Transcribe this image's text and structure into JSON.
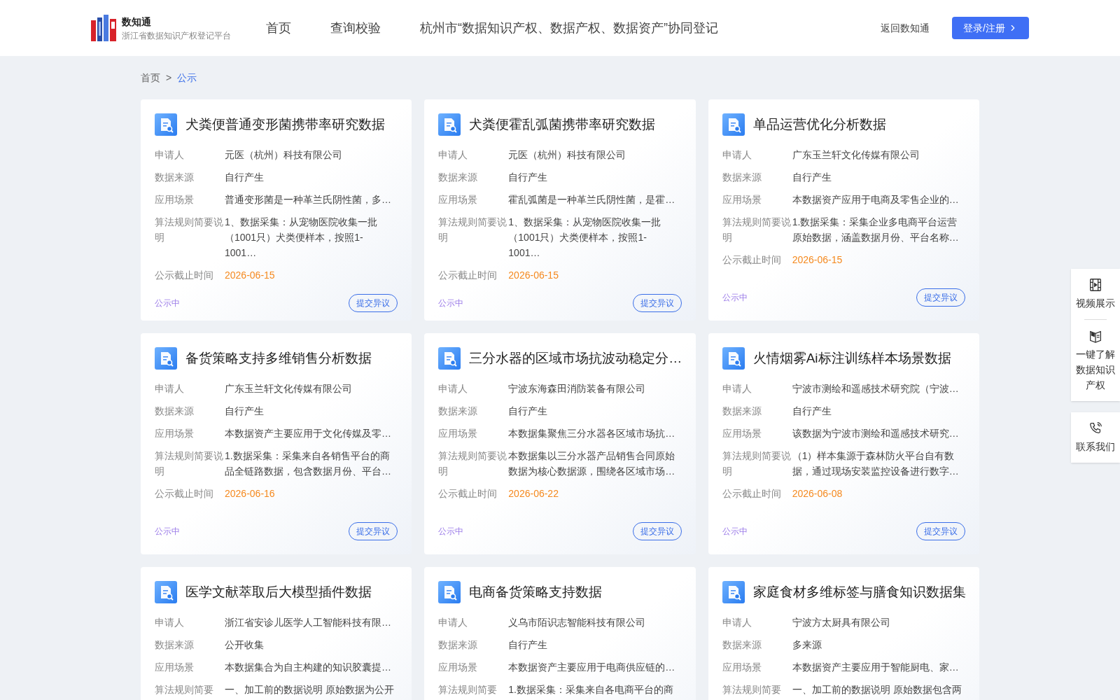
{
  "header": {
    "logo": {
      "title": "数知通",
      "subtitle": "浙江省数据知识产权登记平台"
    },
    "nav": [
      {
        "label": "首页"
      },
      {
        "label": "查询校验"
      },
      {
        "label": "杭州市“数据知识产权、数据产权、数据资产”协同登记"
      }
    ],
    "back_link": "返回数知通",
    "login_button": "登录/注册"
  },
  "breadcrumb": {
    "items": [
      {
        "label": "首页",
        "selected": false
      },
      {
        "label": "公示",
        "selected": true
      }
    ],
    "separator": ">"
  },
  "cards": [
    {
      "title": "犬粪便普通变形菌携带率研究数据",
      "fields": [
        {
          "kind": "text",
          "label": "申请人",
          "value": "元医（杭州）科技有限公司"
        },
        {
          "kind": "text",
          "label": "数据来源",
          "value": "自行产生"
        },
        {
          "kind": "text",
          "label": "应用场景",
          "value": "普通变形菌是一种革兰氏阴性菌，多…"
        },
        {
          "kind": "text",
          "label": "算法规则简要说明",
          "value": "1、数据采集：从宠物医院收集一批（1001只）犬类便样本，按照1-1001…"
        },
        {
          "kind": "date",
          "label": "公示截止时间",
          "value": "2026-06-15"
        }
      ],
      "status": "公示中",
      "action": "提交异议"
    },
    {
      "title": "犬粪便霍乱弧菌携带率研究数据",
      "fields": [
        {
          "kind": "text",
          "label": "申请人",
          "value": "元医（杭州）科技有限公司"
        },
        {
          "kind": "text",
          "label": "数据来源",
          "value": "自行产生"
        },
        {
          "kind": "text",
          "label": "应用场景",
          "value": "霍乱弧菌是一种革兰氏阴性菌，是霍…"
        },
        {
          "kind": "text",
          "label": "算法规则简要说明",
          "value": "1、数据采集：从宠物医院收集一批（1001只）犬类便样本，按照1-1001…"
        },
        {
          "kind": "date",
          "label": "公示截止时间",
          "value": "2026-06-15"
        }
      ],
      "status": "公示中",
      "action": "提交异议"
    },
    {
      "title": "单品运营优化分析数据",
      "fields": [
        {
          "kind": "text",
          "label": "申请人",
          "value": "广东玉兰轩文化传媒有限公司"
        },
        {
          "kind": "text",
          "label": "数据来源",
          "value": "自行产生"
        },
        {
          "kind": "text",
          "label": "应用场景",
          "value": "本数据资产应用于电商及零售企业的…"
        },
        {
          "kind": "text",
          "label": "算法规则简要说明",
          "value": "1.数据采集：采集企业多电商平台运营原始数据，涵盖数据月份、平台名称…"
        },
        {
          "kind": "date",
          "label": "公示截止时间",
          "value": "2026-06-15"
        }
      ],
      "status": "公示中",
      "action": "提交异议"
    },
    {
      "title": "备货策略支持多维销售分析数据",
      "fields": [
        {
          "kind": "text",
          "label": "申请人",
          "value": "广东玉兰轩文化传媒有限公司"
        },
        {
          "kind": "text",
          "label": "数据来源",
          "value": "自行产生"
        },
        {
          "kind": "text",
          "label": "应用场景",
          "value": "本数据资产主要应用于文化传媒及零…"
        },
        {
          "kind": "text",
          "label": "算法规则简要说明",
          "value": "1.数据采集：采集来自各销售平台的商品全链路数据，包含数据月份、平台…"
        },
        {
          "kind": "date",
          "label": "公示截止时间",
          "value": "2026-06-16"
        }
      ],
      "status": "公示中",
      "action": "提交异议"
    },
    {
      "title": "三分水器的区域市场抗波动稳定分…",
      "fields": [
        {
          "kind": "text",
          "label": "申请人",
          "value": "宁波东海森田消防装备有限公司"
        },
        {
          "kind": "text",
          "label": "数据来源",
          "value": "自行产生"
        },
        {
          "kind": "text",
          "label": "应用场景",
          "value": "本数据集聚焦三分水器各区域市场抗…"
        },
        {
          "kind": "text",
          "label": "算法规则简要说明",
          "value": "本数据集以三分水器产品销售合同原始数据为核心数据源，围绕各区域市场…"
        },
        {
          "kind": "date",
          "label": "公示截止时间",
          "value": "2026-06-22"
        }
      ],
      "status": "公示中",
      "action": "提交异议"
    },
    {
      "title": "火情烟雾Ai标注训练样本场景数据",
      "fields": [
        {
          "kind": "text",
          "label": "申请人",
          "value": "宁波市测绘和遥感技术研究院（宁波…"
        },
        {
          "kind": "text",
          "label": "数据来源",
          "value": "自行产生"
        },
        {
          "kind": "text",
          "label": "应用场景",
          "value": "该数据为宁波市测绘和遥感技术研究…"
        },
        {
          "kind": "text",
          "label": "算法规则简要说明",
          "value": "（1）样本集源于森林防火平台自有数据，通过现场安装监控设备进行数字…"
        },
        {
          "kind": "date",
          "label": "公示截止时间",
          "value": "2026-06-08"
        }
      ],
      "status": "公示中",
      "action": "提交异议"
    },
    {
      "title": "医学文献萃取后大模型插件数据",
      "fields": [
        {
          "kind": "text",
          "label": "申请人",
          "value": "浙江省安诊儿医学人工智能科技有限…"
        },
        {
          "kind": "text",
          "label": "数据来源",
          "value": "公开收集"
        },
        {
          "kind": "text",
          "label": "应用场景",
          "value": "本数据集合为自主构建的知识胶囊提…"
        },
        {
          "kind": "text",
          "label": "算法规则简要",
          "value": "一、加工前的数据说明 原始数据为公开"
        }
      ]
    },
    {
      "title": "电商备货策略支持数据",
      "fields": [
        {
          "kind": "text",
          "label": "申请人",
          "value": "义乌市陌识志智能科技有限公司"
        },
        {
          "kind": "text",
          "label": "数据来源",
          "value": "自行产生"
        },
        {
          "kind": "text",
          "label": "应用场景",
          "value": "本数据资产主要应用于电商供应链的…"
        },
        {
          "kind": "text",
          "label": "算法规则简要",
          "value": "1.数据采集：采集来自各电商平台的商"
        }
      ]
    },
    {
      "title": "家庭食材多维标签与膳食知识数据集",
      "fields": [
        {
          "kind": "text",
          "label": "申请人",
          "value": "宁波方太厨具有限公司"
        },
        {
          "kind": "text",
          "label": "数据来源",
          "value": "多来源"
        },
        {
          "kind": "text",
          "label": "应用场景",
          "value": "本数据资产主要应用于智能厨电、家…"
        },
        {
          "kind": "text",
          "label": "算法规则简要",
          "value": "一、加工前的数据说明 原始数据包含两"
        }
      ]
    }
  ],
  "side_panel": {
    "groups": [
      {
        "items": [
          {
            "kind": "video",
            "label": "视频展示"
          },
          {
            "kind": "book",
            "label": "一键了解数据知识产权"
          }
        ]
      },
      {
        "items": [
          {
            "kind": "phone",
            "label": "联系我们"
          }
        ]
      }
    ]
  }
}
